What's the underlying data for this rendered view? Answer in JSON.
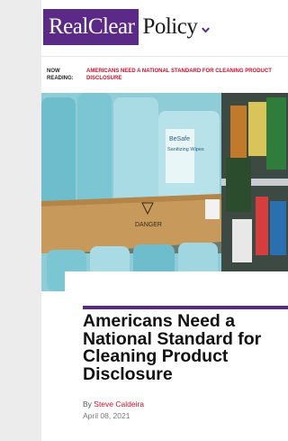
{
  "site": {
    "logo_box": "RealClear",
    "logo_rest": "Policy"
  },
  "now_reading": {
    "label_line1": "NOW",
    "label_line2": "READING:",
    "title": "AMERICANS NEED A NATIONAL STANDARD FOR CLEANING PRODUCT DISCLOSURE"
  },
  "photo": {
    "product_brand": "BeSafe",
    "product_name": "Sanitizing Wipes",
    "box_warning": "DANGER"
  },
  "article": {
    "headline": "Americans Need a National Standard for Cleaning Product Disclosure",
    "by_label": "By ",
    "author": "Steve Caldeira",
    "date": "April 08, 2021"
  },
  "colors": {
    "brand": "#5b2a86",
    "accent": "#c8102e"
  },
  "icons": {
    "menu": "chevron-down-icon"
  }
}
